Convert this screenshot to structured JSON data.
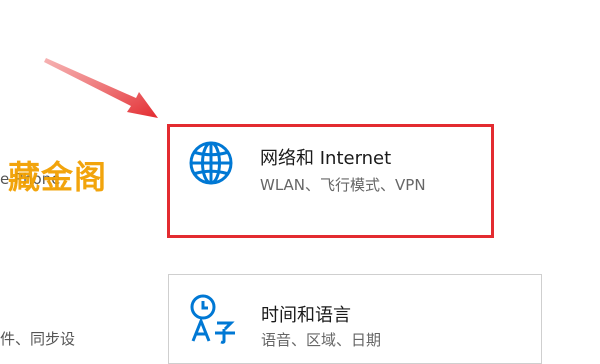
{
  "network": {
    "title": "网络和 Internet",
    "subtitle": "WLAN、飞行模式、VPN",
    "icon": "globe-icon"
  },
  "time_language": {
    "title": "时间和语言",
    "subtitle": "语音、区域、日期",
    "icon": "time-language-icon"
  },
  "left_column": {
    "partial_text_top": "e Phone",
    "partial_text_bottom": "件、同步设"
  },
  "watermark": "藏金阁",
  "colors": {
    "accent": "#0078d4",
    "highlight": "#e32b30",
    "watermark": "#f2a000"
  }
}
